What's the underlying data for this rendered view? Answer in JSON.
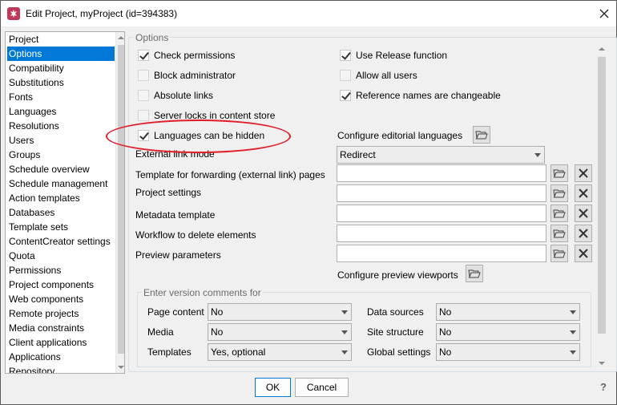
{
  "window": {
    "title": "Edit Project, myProject (id=394383)"
  },
  "nav": {
    "items": [
      {
        "label": "Project",
        "selected": false
      },
      {
        "label": "Options",
        "selected": true
      },
      {
        "label": "Compatibility",
        "selected": false
      },
      {
        "label": "Substitutions",
        "selected": false
      },
      {
        "label": "Fonts",
        "selected": false
      },
      {
        "label": "Languages",
        "selected": false
      },
      {
        "label": "Resolutions",
        "selected": false
      },
      {
        "label": "Users",
        "selected": false
      },
      {
        "label": "Groups",
        "selected": false
      },
      {
        "label": "Schedule overview",
        "selected": false
      },
      {
        "label": "Schedule management",
        "selected": false
      },
      {
        "label": "Action templates",
        "selected": false
      },
      {
        "label": "Databases",
        "selected": false
      },
      {
        "label": "Template sets",
        "selected": false
      },
      {
        "label": "ContentCreator settings",
        "selected": false
      },
      {
        "label": "Quota",
        "selected": false
      },
      {
        "label": "Permissions",
        "selected": false
      },
      {
        "label": "Project components",
        "selected": false
      },
      {
        "label": "Web components",
        "selected": false
      },
      {
        "label": "Remote projects",
        "selected": false
      },
      {
        "label": "Media constraints",
        "selected": false
      },
      {
        "label": "Client applications",
        "selected": false
      },
      {
        "label": "Applications",
        "selected": false
      },
      {
        "label": "Repository",
        "selected": false
      }
    ]
  },
  "options": {
    "group_label": "Options",
    "check_permissions": {
      "label": "Check permissions",
      "checked": true
    },
    "block_administrator": {
      "label": "Block administrator",
      "checked": false
    },
    "absolute_links": {
      "label": "Absolute links",
      "checked": false
    },
    "server_locks": {
      "label": "Server locks in content store",
      "checked": false
    },
    "languages_hidden": {
      "label": "Languages can be hidden",
      "checked": true
    },
    "use_release": {
      "label": "Use Release function",
      "checked": true
    },
    "allow_all_users": {
      "label": "Allow all users",
      "checked": false
    },
    "reference_names": {
      "label": "Reference names are changeable",
      "checked": true
    },
    "configure_editorial_languages": "Configure editorial languages",
    "external_link_mode": {
      "label": "External link mode",
      "value": "Redirect"
    },
    "template_forwarding": {
      "label": "Template for forwarding (external link) pages",
      "value": ""
    },
    "project_settings": {
      "label": "Project settings",
      "value": ""
    },
    "metadata_template": {
      "label": "Metadata template",
      "value": ""
    },
    "workflow_delete": {
      "label": "Workflow to delete elements",
      "value": ""
    },
    "preview_parameters": {
      "label": "Preview parameters",
      "value": ""
    },
    "configure_preview_viewports": "Configure preview viewports"
  },
  "version_comments": {
    "group_label": "Enter version comments for",
    "page_content": {
      "label": "Page content",
      "value": "No"
    },
    "media": {
      "label": "Media",
      "value": "No"
    },
    "templates": {
      "label": "Templates",
      "value": "Yes, optional"
    },
    "data_sources": {
      "label": "Data sources",
      "value": "No"
    },
    "site_structure": {
      "label": "Site structure",
      "value": "No"
    },
    "global_settings": {
      "label": "Global settings",
      "value": "No"
    }
  },
  "buttons": {
    "ok": "OK",
    "cancel": "Cancel",
    "help": "?"
  },
  "colors": {
    "selection": "#0078d7",
    "annotation": "#e21d2a"
  },
  "icons": [
    "app-icon",
    "close-icon",
    "folder-open-icon",
    "delete-x-icon",
    "help-icon"
  ]
}
